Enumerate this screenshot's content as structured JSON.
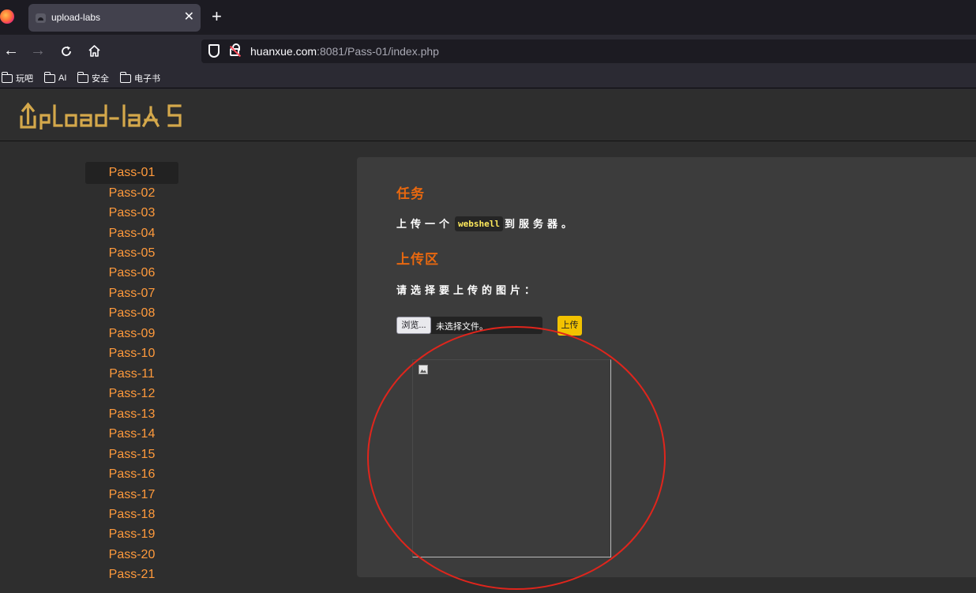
{
  "browser": {
    "tab_title": "upload-labs",
    "url_host": "huanxue.com",
    "url_rest": ":8081/Pass-01/index.php",
    "bookmarks": [
      "玩吧",
      "AI",
      "安全",
      "电子书"
    ]
  },
  "sidebar": {
    "active": "Pass-01",
    "items": [
      "Pass-01",
      "Pass-02",
      "Pass-03",
      "Pass-04",
      "Pass-05",
      "Pass-06",
      "Pass-07",
      "Pass-08",
      "Pass-09",
      "Pass-10",
      "Pass-11",
      "Pass-12",
      "Pass-13",
      "Pass-14",
      "Pass-15",
      "Pass-16",
      "Pass-17",
      "Pass-18",
      "Pass-19",
      "Pass-20",
      "Pass-21"
    ]
  },
  "main": {
    "task_heading": "任务",
    "task_prefix": "上传一个",
    "task_code": "webshell",
    "task_suffix": "到服务器。",
    "upload_heading": "上传区",
    "upload_prompt": "请选择要上传的图片：",
    "browse_label": "浏览...",
    "file_status": "未选择文件。",
    "upload_button": "上传"
  },
  "colors": {
    "accent": "#e8680f",
    "sidebar_link": "#ff9a3c",
    "upload_button": "#f2c200",
    "annotation": "#e0251c"
  }
}
